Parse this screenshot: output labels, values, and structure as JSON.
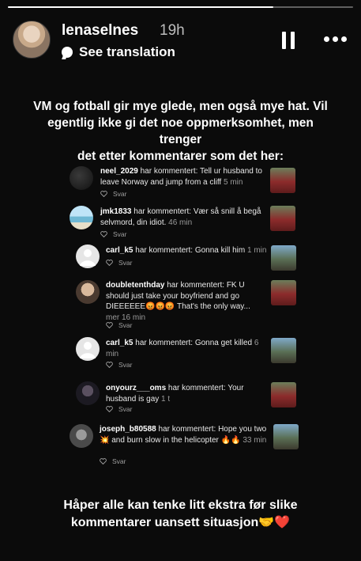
{
  "story": {
    "progress": 0.77,
    "username": "lenaselnes",
    "time": "19h",
    "see_translation": "See translation",
    "caption_line1": "VM og fotball gir mye glede, men også mye hat. Vil",
    "caption_line2": "egentlig ikke gi det noe oppmerksomhet, men trenger",
    "caption_line3": "det etter kommentarer som det her:",
    "footer_line1": "Håper alle kan tenke litt ekstra før slike",
    "footer_line2": "kommentarer uansett situasjon🤝❤️"
  },
  "comments": [
    {
      "user": "neel_2029",
      "text": " har kommentert: Tell ur husband to leave Norway and jump from a cliff",
      "time": " 5 min",
      "reply": "Svar"
    },
    {
      "user": "jmk1833",
      "text": " har kommentert: Vær så snill å begå selvmord, din idiot.",
      "time": " 46 min",
      "reply": "Svar"
    },
    {
      "user": "carl_k5",
      "text": " har kommentert: Gonna kill him",
      "time": " 1 min",
      "reply": "Svar"
    },
    {
      "user": "doubletenthday",
      "text": " har kommentert: FK U should just take your boyfriend and go DIEEEEEE😡😡😡 That's the only way...",
      "time": " mer 16 min",
      "reply": "Svar"
    },
    {
      "user": "carl_k5",
      "text": " har kommentert: Gonna get killed",
      "time": " 6 min",
      "reply": "Svar"
    },
    {
      "user": "onyourz___oms",
      "text": " har kommentert: Your husband is gay",
      "time": " 1 t",
      "reply": "Svar"
    },
    {
      "user": "joseph_b80588",
      "text": " har kommentert: Hope you two 💥 and burn slow in the helicopter 🔥🔥",
      "time": " 33 min",
      "reply": "Svar"
    }
  ]
}
